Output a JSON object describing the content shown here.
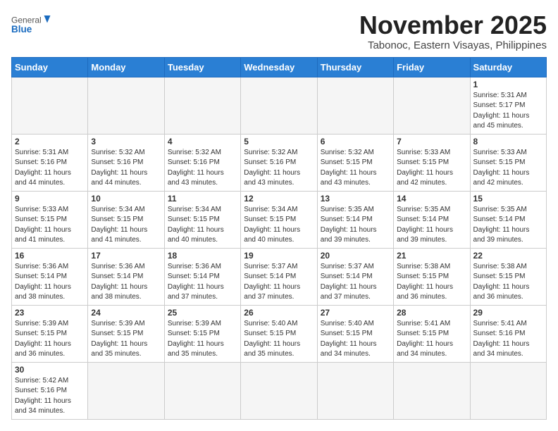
{
  "header": {
    "logo_general": "General",
    "logo_blue": "Blue",
    "month_title": "November 2025",
    "location": "Tabonoc, Eastern Visayas, Philippines"
  },
  "weekdays": [
    "Sunday",
    "Monday",
    "Tuesday",
    "Wednesday",
    "Thursday",
    "Friday",
    "Saturday"
  ],
  "weeks": [
    [
      {
        "day": "",
        "info": ""
      },
      {
        "day": "",
        "info": ""
      },
      {
        "day": "",
        "info": ""
      },
      {
        "day": "",
        "info": ""
      },
      {
        "day": "",
        "info": ""
      },
      {
        "day": "",
        "info": ""
      },
      {
        "day": "1",
        "info": "Sunrise: 5:31 AM\nSunset: 5:17 PM\nDaylight: 11 hours\nand 45 minutes."
      }
    ],
    [
      {
        "day": "2",
        "info": "Sunrise: 5:31 AM\nSunset: 5:16 PM\nDaylight: 11 hours\nand 44 minutes."
      },
      {
        "day": "3",
        "info": "Sunrise: 5:32 AM\nSunset: 5:16 PM\nDaylight: 11 hours\nand 44 minutes."
      },
      {
        "day": "4",
        "info": "Sunrise: 5:32 AM\nSunset: 5:16 PM\nDaylight: 11 hours\nand 43 minutes."
      },
      {
        "day": "5",
        "info": "Sunrise: 5:32 AM\nSunset: 5:16 PM\nDaylight: 11 hours\nand 43 minutes."
      },
      {
        "day": "6",
        "info": "Sunrise: 5:32 AM\nSunset: 5:15 PM\nDaylight: 11 hours\nand 43 minutes."
      },
      {
        "day": "7",
        "info": "Sunrise: 5:33 AM\nSunset: 5:15 PM\nDaylight: 11 hours\nand 42 minutes."
      },
      {
        "day": "8",
        "info": "Sunrise: 5:33 AM\nSunset: 5:15 PM\nDaylight: 11 hours\nand 42 minutes."
      }
    ],
    [
      {
        "day": "9",
        "info": "Sunrise: 5:33 AM\nSunset: 5:15 PM\nDaylight: 11 hours\nand 41 minutes."
      },
      {
        "day": "10",
        "info": "Sunrise: 5:34 AM\nSunset: 5:15 PM\nDaylight: 11 hours\nand 41 minutes."
      },
      {
        "day": "11",
        "info": "Sunrise: 5:34 AM\nSunset: 5:15 PM\nDaylight: 11 hours\nand 40 minutes."
      },
      {
        "day": "12",
        "info": "Sunrise: 5:34 AM\nSunset: 5:15 PM\nDaylight: 11 hours\nand 40 minutes."
      },
      {
        "day": "13",
        "info": "Sunrise: 5:35 AM\nSunset: 5:14 PM\nDaylight: 11 hours\nand 39 minutes."
      },
      {
        "day": "14",
        "info": "Sunrise: 5:35 AM\nSunset: 5:14 PM\nDaylight: 11 hours\nand 39 minutes."
      },
      {
        "day": "15",
        "info": "Sunrise: 5:35 AM\nSunset: 5:14 PM\nDaylight: 11 hours\nand 39 minutes."
      }
    ],
    [
      {
        "day": "16",
        "info": "Sunrise: 5:36 AM\nSunset: 5:14 PM\nDaylight: 11 hours\nand 38 minutes."
      },
      {
        "day": "17",
        "info": "Sunrise: 5:36 AM\nSunset: 5:14 PM\nDaylight: 11 hours\nand 38 minutes."
      },
      {
        "day": "18",
        "info": "Sunrise: 5:36 AM\nSunset: 5:14 PM\nDaylight: 11 hours\nand 37 minutes."
      },
      {
        "day": "19",
        "info": "Sunrise: 5:37 AM\nSunset: 5:14 PM\nDaylight: 11 hours\nand 37 minutes."
      },
      {
        "day": "20",
        "info": "Sunrise: 5:37 AM\nSunset: 5:14 PM\nDaylight: 11 hours\nand 37 minutes."
      },
      {
        "day": "21",
        "info": "Sunrise: 5:38 AM\nSunset: 5:15 PM\nDaylight: 11 hours\nand 36 minutes."
      },
      {
        "day": "22",
        "info": "Sunrise: 5:38 AM\nSunset: 5:15 PM\nDaylight: 11 hours\nand 36 minutes."
      }
    ],
    [
      {
        "day": "23",
        "info": "Sunrise: 5:39 AM\nSunset: 5:15 PM\nDaylight: 11 hours\nand 36 minutes."
      },
      {
        "day": "24",
        "info": "Sunrise: 5:39 AM\nSunset: 5:15 PM\nDaylight: 11 hours\nand 35 minutes."
      },
      {
        "day": "25",
        "info": "Sunrise: 5:39 AM\nSunset: 5:15 PM\nDaylight: 11 hours\nand 35 minutes."
      },
      {
        "day": "26",
        "info": "Sunrise: 5:40 AM\nSunset: 5:15 PM\nDaylight: 11 hours\nand 35 minutes."
      },
      {
        "day": "27",
        "info": "Sunrise: 5:40 AM\nSunset: 5:15 PM\nDaylight: 11 hours\nand 34 minutes."
      },
      {
        "day": "28",
        "info": "Sunrise: 5:41 AM\nSunset: 5:15 PM\nDaylight: 11 hours\nand 34 minutes."
      },
      {
        "day": "29",
        "info": "Sunrise: 5:41 AM\nSunset: 5:16 PM\nDaylight: 11 hours\nand 34 minutes."
      }
    ],
    [
      {
        "day": "30",
        "info": "Sunrise: 5:42 AM\nSunset: 5:16 PM\nDaylight: 11 hours\nand 34 minutes."
      },
      {
        "day": "",
        "info": ""
      },
      {
        "day": "",
        "info": ""
      },
      {
        "day": "",
        "info": ""
      },
      {
        "day": "",
        "info": ""
      },
      {
        "day": "",
        "info": ""
      },
      {
        "day": "",
        "info": ""
      }
    ]
  ]
}
